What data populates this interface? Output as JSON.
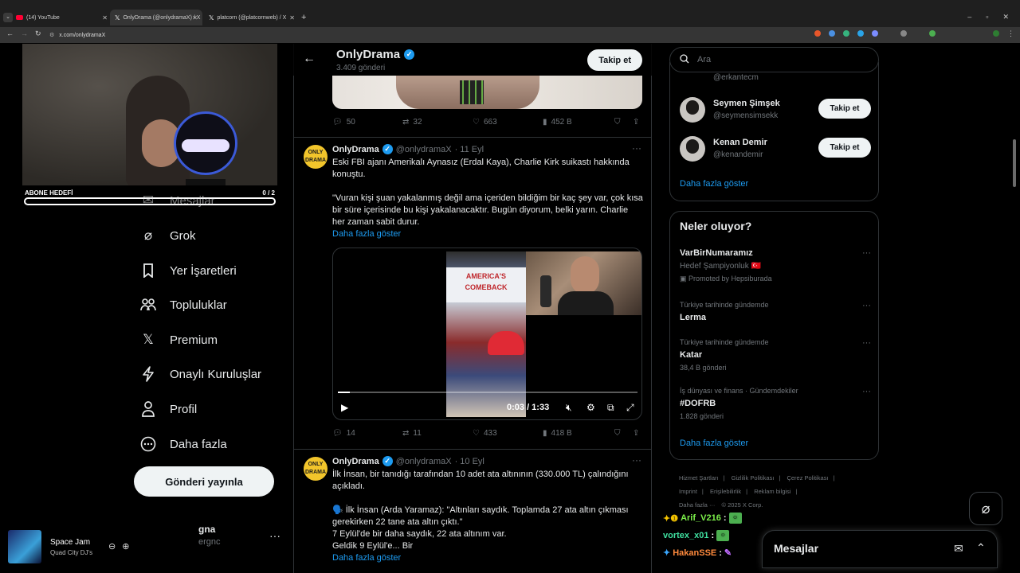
{
  "browser": {
    "tabs": [
      {
        "label": "(14) YouTube",
        "icon": "youtube-icon"
      },
      {
        "label": "OnlyDrama (@onlydramaX) / X",
        "icon": "x-icon"
      },
      {
        "label": "platcorn (@platcornweb) / X",
        "icon": "x-icon"
      }
    ],
    "new_tab": "+",
    "url": "x.com/onlydramaX"
  },
  "stream": {
    "goal_label": "ABONE HEDEFİ",
    "goal_count": "0 / 2",
    "goal_progress": 0.0,
    "music_title": "Space Jam",
    "music_artist": "Quad City DJ's",
    "chat": [
      {
        "user": "Arif_V216",
        "sep": ":",
        "color": "#7cf04a",
        "prefix": "✦❶"
      },
      {
        "user": "vortex_x01",
        "sep": ":",
        "color": "#3fe0a0",
        "prefix": ""
      },
      {
        "user": "HakanSSE",
        "sep": ":",
        "color": "#3aa7ff",
        "prefix": "✦"
      }
    ]
  },
  "nav": {
    "items": [
      {
        "label": "Mesajlar",
        "icon": "mail-icon"
      },
      {
        "label": "Grok",
        "icon": "grok-icon"
      },
      {
        "label": "Yer İşaretleri",
        "icon": "bookmark-icon"
      },
      {
        "label": "Topluluklar",
        "icon": "communities-icon"
      },
      {
        "label": "Premium",
        "icon": "x-logo-icon"
      },
      {
        "label": "Onaylı Kuruluşlar",
        "icon": "lightning-icon"
      },
      {
        "label": "Profil",
        "icon": "person-icon"
      },
      {
        "label": "Daha fazla",
        "icon": "more-circle-icon"
      }
    ],
    "post_button": "Gönderi yayınla",
    "account_name": "gna",
    "account_handle": "ergnc",
    "account_more": "···"
  },
  "profile_header": {
    "name": "OnlyDrama",
    "posts": "3.409 gönderi",
    "follow": "Takip et"
  },
  "tweets": [
    {
      "replies": "50",
      "retweets": "32",
      "likes": "663",
      "views": "452 B"
    },
    {
      "name": "OnlyDrama",
      "handle": "@onlydramaX",
      "date": "· 11 Eyl",
      "text1": "Eski FBI ajanı Amerikalı Aynasız (Erdal Kaya), Charlie Kirk suikastı hakkında konuştu.",
      "text2": "\"Vuran kişi şuan yakalanmış değil ama içeriden bildiğim bir kaç şey var, çok kısa bir süre içerisinde bu kişi yakalanacaktır. Bugün diyorum, belki yarın. Charlie her zaman sabit durur.",
      "show_more": "Daha fazla göster",
      "video_time": "0:03 / 1:33",
      "video_progress": 0.04,
      "video_banner": "AMERICA'S COMEBACK",
      "replies": "14",
      "retweets": "11",
      "likes": "433",
      "views": "418 B"
    },
    {
      "name": "OnlyDrama",
      "handle": "@onlydramaX",
      "date": "· 10 Eyl",
      "text1": "İlk İnsan, bir tanıdığı tarafından 10 adet ata altınının (330.000 TL) çalındığını açıkladı.",
      "text2": "🗣️ İlk İnsan (Arda Yaramaz): \"Altınları saydık. Toplamda 27 ata altın çıkması gerekirken 22 tane ata altın çıktı.\"",
      "text3": "7 Eylül'de bir daha saydık, 22 ata altınım var.",
      "text4": "Geldik 9 Eylül'e... Bir",
      "show_more": "Daha fazla göster"
    }
  ],
  "sidebar": {
    "search_placeholder": "Ara",
    "partial_handle": "@erkantecm",
    "who_to_follow": [
      {
        "name": "Seymen Şimşek",
        "handle": "@seymensimsekk",
        "button": "Takip et"
      },
      {
        "name": "Kenan Demir",
        "handle": "@kenandemir",
        "button": "Takip et"
      }
    ],
    "who_more": "Daha fazla göster",
    "trends_title": "Neler oluyor?",
    "trends": [
      {
        "title": "VarBirNumaramız",
        "context": "Hedef Şampiyonluk 🇹🇷",
        "count": "Promoted by Hepsiburada"
      },
      {
        "context": "Türkiye tarihinde gündemde",
        "title": "Lerma",
        "count": ""
      },
      {
        "context": "Türkiye tarihinde gündemde",
        "title": "Katar",
        "count": "38,4 B gönderi"
      },
      {
        "context": "İş dünyası ve finans · Gündemdekiler",
        "title": "#DOFRB",
        "count": "1.828 gönderi"
      }
    ],
    "trends_more": "Daha fazla göster",
    "footer": [
      "Hizmet Şartları",
      "|",
      "Gizlilik Politikası",
      "|",
      "Çerez Politikası",
      "|",
      "Imprint",
      "|",
      "Erişilebilirlik",
      "|",
      "Reklam bilgisi",
      "|",
      "Daha fazla ···",
      "© 2025 X Corp."
    ],
    "dm_title": "Mesajlar"
  }
}
